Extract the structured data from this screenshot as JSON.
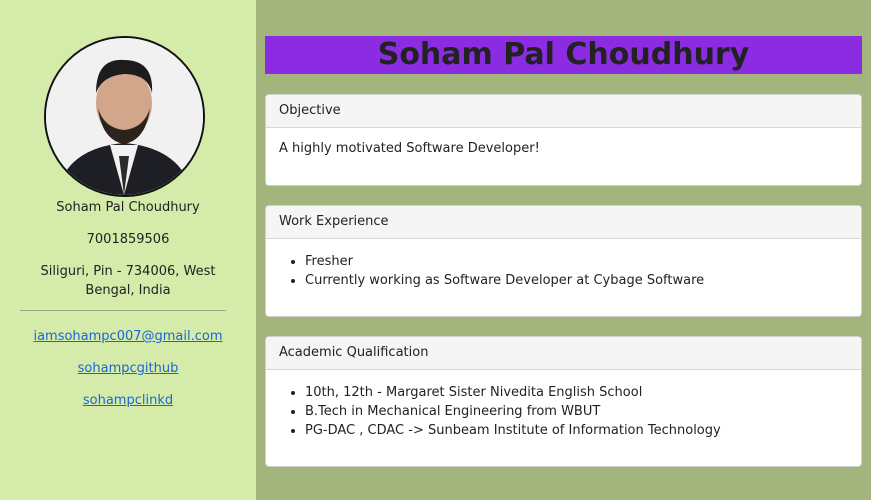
{
  "profile": {
    "name": "Soham Pal Choudhury",
    "phone": "7001859506",
    "address": "Siliguri, Pin - 734006, West Bengal, India",
    "email": "iamsohampc007@gmail.com",
    "github": "sohampcgithub",
    "linkedin": "sohampclinkd"
  },
  "header": {
    "title": "Soham Pal Choudhury"
  },
  "sections": {
    "objective": {
      "title": "Objective",
      "text": "A highly motivated Software Developer!"
    },
    "experience": {
      "title": "Work Experience",
      "items": [
        "Fresher",
        "Currently working as Software Developer at Cybage Software"
      ]
    },
    "academic": {
      "title": "Academic Qualification",
      "items": [
        "10th, 12th - Margaret Sister Nivedita English School",
        "B.Tech in Mechanical Engineering from WBUT",
        "PG-DAC , CDAC -> Sunbeam Institute of Information Technology"
      ]
    }
  },
  "colors": {
    "sidebar_bg": "#d4ebaa",
    "main_bg": "#a3b57c",
    "title_bg": "#8b2be2",
    "link": "#1a66d6"
  }
}
